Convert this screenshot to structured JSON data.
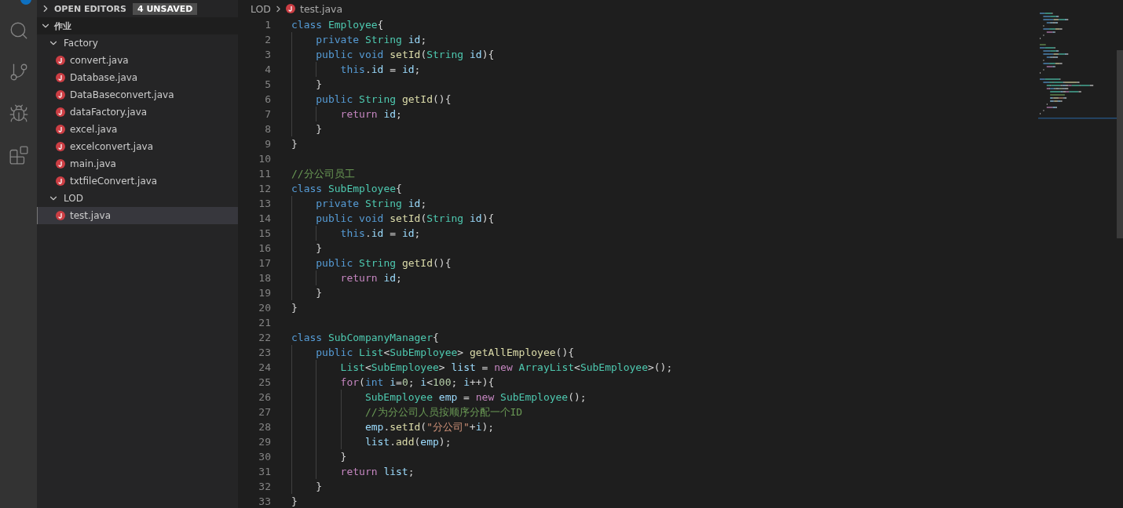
{
  "activity_bar": {
    "items": [
      {
        "kind": "search",
        "selected": false
      },
      {
        "kind": "source-control",
        "selected": false
      },
      {
        "kind": "debug",
        "selected": false
      },
      {
        "kind": "extensions",
        "selected": false
      }
    ]
  },
  "sidebar": {
    "open_editors": {
      "title": "OPEN EDITORS",
      "badge": "4 UNSAVED",
      "expanded": false
    },
    "workspace": {
      "title": "作业",
      "expanded": true,
      "children": [
        {
          "label": "Factory",
          "kind": "folder",
          "expanded": true,
          "selected": false,
          "children": [
            {
              "label": "convert.java",
              "kind": "java",
              "selected": false
            },
            {
              "label": "Database.java",
              "kind": "java",
              "selected": false
            },
            {
              "label": "DataBaseconvert.java",
              "kind": "java",
              "selected": false
            },
            {
              "label": "dataFactory.java",
              "kind": "java",
              "selected": false
            },
            {
              "label": "excel.java",
              "kind": "java",
              "selected": false
            },
            {
              "label": "excelconvert.java",
              "kind": "java",
              "selected": false
            },
            {
              "label": "main.java",
              "kind": "java",
              "selected": false
            },
            {
              "label": "txtfileConvert.java",
              "kind": "java",
              "selected": false
            }
          ]
        },
        {
          "label": "LOD",
          "kind": "folder",
          "expanded": true,
          "selected": false,
          "children": [
            {
              "label": "test.java",
              "kind": "java",
              "selected": true
            }
          ]
        }
      ]
    }
  },
  "editor": {
    "breadcrumb": [
      {
        "label": "LOD",
        "kind": "folder"
      },
      {
        "label": "test.java",
        "kind": "java"
      }
    ],
    "lines": [
      {
        "number": "1",
        "tokens": [
          {
            "kind": "kw",
            "text": "class "
          },
          {
            "kind": "type",
            "text": "Employee"
          },
          {
            "kind": "p",
            "text": "{"
          }
        ]
      },
      {
        "number": "2",
        "tokens": [
          {
            "kind": "indent"
          },
          {
            "kind": "kw",
            "text": "private "
          },
          {
            "kind": "type",
            "text": "String "
          },
          {
            "kind": "var",
            "text": "id"
          },
          {
            "kind": "p",
            "text": ";"
          }
        ]
      },
      {
        "number": "3",
        "tokens": [
          {
            "kind": "indent"
          },
          {
            "kind": "kw",
            "text": "public "
          },
          {
            "kind": "kw",
            "text": "void "
          },
          {
            "kind": "fn",
            "text": "setId"
          },
          {
            "kind": "p",
            "text": "("
          },
          {
            "kind": "type",
            "text": "String "
          },
          {
            "kind": "var",
            "text": "id"
          },
          {
            "kind": "p",
            "text": "){"
          }
        ]
      },
      {
        "number": "4",
        "tokens": [
          {
            "kind": "indent"
          },
          {
            "kind": "indent"
          },
          {
            "kind": "kw",
            "text": "this"
          },
          {
            "kind": "p",
            "text": "."
          },
          {
            "kind": "var",
            "text": "id"
          },
          {
            "kind": "p",
            "text": " = "
          },
          {
            "kind": "var",
            "text": "id"
          },
          {
            "kind": "p",
            "text": ";"
          }
        ]
      },
      {
        "number": "5",
        "tokens": [
          {
            "kind": "indent"
          },
          {
            "kind": "p",
            "text": "}"
          }
        ]
      },
      {
        "number": "6",
        "tokens": [
          {
            "kind": "indent"
          },
          {
            "kind": "kw",
            "text": "public "
          },
          {
            "kind": "type",
            "text": "String "
          },
          {
            "kind": "fn",
            "text": "getId"
          },
          {
            "kind": "p",
            "text": "(){"
          }
        ]
      },
      {
        "number": "7",
        "tokens": [
          {
            "kind": "indent"
          },
          {
            "kind": "indent"
          },
          {
            "kind": "ctl",
            "text": "return "
          },
          {
            "kind": "var",
            "text": "id"
          },
          {
            "kind": "p",
            "text": ";"
          }
        ]
      },
      {
        "number": "8",
        "tokens": [
          {
            "kind": "indent"
          },
          {
            "kind": "p",
            "text": "}"
          }
        ]
      },
      {
        "number": "9",
        "tokens": [
          {
            "kind": "p",
            "text": "}"
          }
        ]
      },
      {
        "number": "10"
      },
      {
        "number": "11",
        "tokens": [
          {
            "kind": "cm",
            "text": "//分公司员工"
          }
        ]
      },
      {
        "number": "12",
        "tokens": [
          {
            "kind": "kw",
            "text": "class "
          },
          {
            "kind": "type",
            "text": "SubEmployee"
          },
          {
            "kind": "p",
            "text": "{"
          }
        ]
      },
      {
        "number": "13",
        "tokens": [
          {
            "kind": "indent"
          },
          {
            "kind": "kw",
            "text": "private "
          },
          {
            "kind": "type",
            "text": "String "
          },
          {
            "kind": "var",
            "text": "id"
          },
          {
            "kind": "p",
            "text": ";"
          }
        ]
      },
      {
        "number": "14",
        "tokens": [
          {
            "kind": "indent"
          },
          {
            "kind": "kw",
            "text": "public "
          },
          {
            "kind": "kw",
            "text": "void "
          },
          {
            "kind": "fn",
            "text": "setId"
          },
          {
            "kind": "p",
            "text": "("
          },
          {
            "kind": "type",
            "text": "String "
          },
          {
            "kind": "var",
            "text": "id"
          },
          {
            "kind": "p",
            "text": "){"
          }
        ]
      },
      {
        "number": "15",
        "tokens": [
          {
            "kind": "indent"
          },
          {
            "kind": "indent"
          },
          {
            "kind": "kw",
            "text": "this"
          },
          {
            "kind": "p",
            "text": "."
          },
          {
            "kind": "var",
            "text": "id"
          },
          {
            "kind": "p",
            "text": " = "
          },
          {
            "kind": "var",
            "text": "id"
          },
          {
            "kind": "p",
            "text": ";"
          }
        ]
      },
      {
        "number": "16",
        "tokens": [
          {
            "kind": "indent"
          },
          {
            "kind": "p",
            "text": "}"
          }
        ]
      },
      {
        "number": "17",
        "tokens": [
          {
            "kind": "indent"
          },
          {
            "kind": "kw",
            "text": "public "
          },
          {
            "kind": "type",
            "text": "String "
          },
          {
            "kind": "fn",
            "text": "getId"
          },
          {
            "kind": "p",
            "text": "(){"
          }
        ]
      },
      {
        "number": "18",
        "tokens": [
          {
            "kind": "indent"
          },
          {
            "kind": "indent"
          },
          {
            "kind": "ctl",
            "text": "return "
          },
          {
            "kind": "var",
            "text": "id"
          },
          {
            "kind": "p",
            "text": ";"
          }
        ]
      },
      {
        "number": "19",
        "tokens": [
          {
            "kind": "indent"
          },
          {
            "kind": "p",
            "text": "}"
          }
        ]
      },
      {
        "number": "20",
        "tokens": [
          {
            "kind": "p",
            "text": "}"
          }
        ]
      },
      {
        "number": "21"
      },
      {
        "number": "22",
        "tokens": [
          {
            "kind": "kw",
            "text": "class "
          },
          {
            "kind": "type",
            "text": "SubCompanyManager"
          },
          {
            "kind": "p",
            "text": "{"
          }
        ]
      },
      {
        "number": "23",
        "tokens": [
          {
            "kind": "indent"
          },
          {
            "kind": "kw",
            "text": "public "
          },
          {
            "kind": "type",
            "text": "List"
          },
          {
            "kind": "p",
            "text": "<"
          },
          {
            "kind": "type",
            "text": "SubEmployee"
          },
          {
            "kind": "p",
            "text": "> "
          },
          {
            "kind": "fn",
            "text": "getAllEmployee"
          },
          {
            "kind": "p",
            "text": "(){"
          }
        ]
      },
      {
        "number": "24",
        "tokens": [
          {
            "kind": "indent"
          },
          {
            "kind": "indent"
          },
          {
            "kind": "type",
            "text": "List"
          },
          {
            "kind": "p",
            "text": "<"
          },
          {
            "kind": "type",
            "text": "SubEmployee"
          },
          {
            "kind": "p",
            "text": "> "
          },
          {
            "kind": "var",
            "text": "list"
          },
          {
            "kind": "p",
            "text": " = "
          },
          {
            "kind": "ctl",
            "text": "new "
          },
          {
            "kind": "type",
            "text": "ArrayList"
          },
          {
            "kind": "p",
            "text": "<"
          },
          {
            "kind": "type",
            "text": "SubEmployee"
          },
          {
            "kind": "p",
            "text": ">();"
          }
        ]
      },
      {
        "number": "25",
        "tokens": [
          {
            "kind": "indent"
          },
          {
            "kind": "indent"
          },
          {
            "kind": "ctl",
            "text": "for"
          },
          {
            "kind": "p",
            "text": "("
          },
          {
            "kind": "kw",
            "text": "int "
          },
          {
            "kind": "var",
            "text": "i"
          },
          {
            "kind": "p",
            "text": "="
          },
          {
            "kind": "num",
            "text": "0"
          },
          {
            "kind": "p",
            "text": "; "
          },
          {
            "kind": "var",
            "text": "i"
          },
          {
            "kind": "p",
            "text": "<"
          },
          {
            "kind": "num",
            "text": "100"
          },
          {
            "kind": "p",
            "text": "; "
          },
          {
            "kind": "var",
            "text": "i"
          },
          {
            "kind": "p",
            "text": "++){"
          }
        ]
      },
      {
        "number": "26",
        "tokens": [
          {
            "kind": "indent"
          },
          {
            "kind": "indent"
          },
          {
            "kind": "indent"
          },
          {
            "kind": "type",
            "text": "SubEmployee "
          },
          {
            "kind": "var",
            "text": "emp"
          },
          {
            "kind": "p",
            "text": " = "
          },
          {
            "kind": "ctl",
            "text": "new "
          },
          {
            "kind": "type",
            "text": "SubEmployee"
          },
          {
            "kind": "p",
            "text": "();"
          }
        ]
      },
      {
        "number": "27",
        "tokens": [
          {
            "kind": "indent"
          },
          {
            "kind": "indent"
          },
          {
            "kind": "indent"
          },
          {
            "kind": "cm",
            "text": "//为分公司人员按顺序分配一个ID"
          }
        ]
      },
      {
        "number": "28",
        "tokens": [
          {
            "kind": "indent"
          },
          {
            "kind": "indent"
          },
          {
            "kind": "indent"
          },
          {
            "kind": "var",
            "text": "emp"
          },
          {
            "kind": "p",
            "text": "."
          },
          {
            "kind": "fn",
            "text": "setId"
          },
          {
            "kind": "p",
            "text": "("
          },
          {
            "kind": "str",
            "text": "\"分公司\""
          },
          {
            "kind": "p",
            "text": "+"
          },
          {
            "kind": "var",
            "text": "i"
          },
          {
            "kind": "p",
            "text": ");"
          }
        ]
      },
      {
        "number": "29",
        "tokens": [
          {
            "kind": "indent"
          },
          {
            "kind": "indent"
          },
          {
            "kind": "indent"
          },
          {
            "kind": "var",
            "text": "list"
          },
          {
            "kind": "p",
            "text": "."
          },
          {
            "kind": "fn",
            "text": "add"
          },
          {
            "kind": "p",
            "text": "("
          },
          {
            "kind": "var",
            "text": "emp"
          },
          {
            "kind": "p",
            "text": ");"
          }
        ]
      },
      {
        "number": "30",
        "tokens": [
          {
            "kind": "indent"
          },
          {
            "kind": "indent"
          },
          {
            "kind": "p",
            "text": "}"
          }
        ]
      },
      {
        "number": "31",
        "tokens": [
          {
            "kind": "indent"
          },
          {
            "kind": "indent"
          },
          {
            "kind": "ctl",
            "text": "return "
          },
          {
            "kind": "var",
            "text": "list"
          },
          {
            "kind": "p",
            "text": ";"
          }
        ]
      },
      {
        "number": "32",
        "tokens": [
          {
            "kind": "indent"
          },
          {
            "kind": "p",
            "text": "}"
          }
        ]
      },
      {
        "number": "33",
        "tokens": [
          {
            "kind": "p",
            "text": "}"
          }
        ]
      }
    ]
  }
}
